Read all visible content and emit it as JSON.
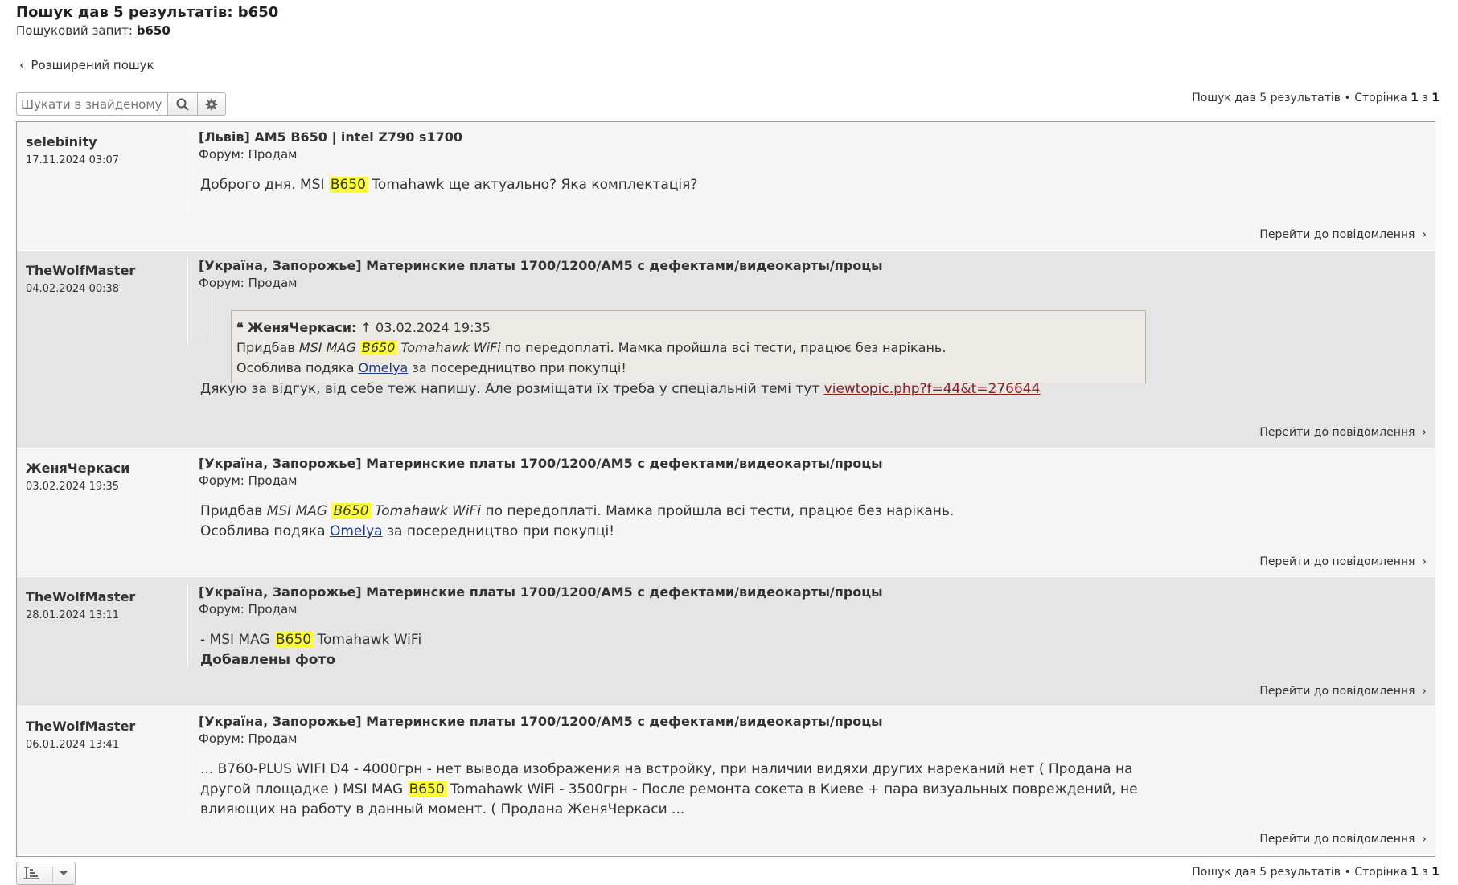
{
  "header": {
    "title": "Пошук дав 5 результатів: b650",
    "query_label": "Пошуковий запит:",
    "query_value": "b650",
    "advanced_link": "Розширений пошук"
  },
  "search_within": {
    "placeholder": "Шукати в знайденому"
  },
  "pagination": {
    "prefix": "Пошук дав 5 результатів • Сторінка",
    "current": "1",
    "sep": "з",
    "total": "1"
  },
  "posts": [
    {
      "author": "selebinity",
      "date": "17.11.2024 03:07",
      "title": "[Львів] AM5 B650 | intel Z790 s1700",
      "forum": "Форум: Продам",
      "text_before": "Доброго дня. MSI",
      "highlight": "B650",
      "text_after": "Tomahawk ще актуально? Яка комплектація?",
      "goto": "Перейти до повідомлення"
    },
    {
      "author": "TheWolfMaster",
      "date": "04.02.2024 00:38",
      "title": "[Україна, Запорожье] Материнские платы 1700/1200/AM5 с дефектами/видеокарты/процы",
      "forum": "Форум: Продам",
      "quote_author": "ЖеняЧеркаси:",
      "quote_arrow": "↑",
      "quote_date": "03.02.2024 19:35",
      "quote_line1_before": "Придбав",
      "quote_line1_italic1": "MSI MAG",
      "quote_line1_highlight": "B650",
      "quote_line1_italic2": "Tomahawk WiFi",
      "quote_line1_after": "по передоплаті. Мамка пройшла всі тести, працює без нарікань.",
      "quote_line2_before": "Особлива подяка",
      "quote_line2_link": "Omelya",
      "quote_line2_after": "за посередництво при покупці!",
      "text_before": "Дякую за відгук, від себе теж напишу. Але розміщати їх треба у спеціальній темі тут",
      "link": "viewtopic.php?f=44&t=276644",
      "goto": "Перейти до повідомлення"
    },
    {
      "author": "ЖеняЧеркаси",
      "date": "03.02.2024 19:35",
      "title": "[Україна, Запорожье] Материнские платы 1700/1200/AM5 с дефектами/видеокарты/процы",
      "forum": "Форум: Продам",
      "line1_before": "Придбав",
      "line1_italic1": "MSI MAG",
      "line1_highlight": "B650",
      "line1_italic2": "Tomahawk WiFi",
      "line1_after": "по передоплаті. Мамка пройшла всі тести, працює без нарікань.",
      "line2_before": "Особлива подяка",
      "line2_link": "Omelya",
      "line2_after": "за посередництво при покупці!",
      "goto": "Перейти до повідомлення"
    },
    {
      "author": "TheWolfMaster",
      "date": "28.01.2024 13:11",
      "title": "[Україна, Запорожье] Материнские платы 1700/1200/AM5 с дефектами/видеокарты/процы",
      "forum": "Форум: Продам",
      "line1_before": "- MSI MAG",
      "line1_highlight": "B650",
      "line1_after": "Tomahawk WiFi",
      "line2_bold": "Добавлены фото",
      "goto": "Перейти до повідомлення"
    },
    {
      "author": "TheWolfMaster",
      "date": "06.01.2024 13:41",
      "title": "[Україна, Запорожье] Материнские платы 1700/1200/AM5 с дефектами/видеокарты/процы",
      "forum": "Форум: Продам",
      "line1": "... B760-PLUS WIFI D4 - 4000грн - нет вывода изображения на встройку, при наличии видяхи других нареканий нет ( Продана на",
      "line2_before": "другой площадке ) MSI MAG",
      "line2_highlight": "B650",
      "line2_after": "Tomahawk WiFi - 3500грн - После ремонта сокета в Киеве + пара визуальных повреждений, не",
      "line3": "влияющих на работу в данный момент. ( Продана ЖеняЧеркаси ...",
      "goto": "Перейти до повідомлення"
    }
  ],
  "colors": {
    "highlight": "#ffff33",
    "row_light": "#f5f5f5",
    "row_dark": "#e5e5e5",
    "quote_bg": "#ebeae4",
    "link": "#1a3a8a",
    "link_visited": "#8a1e1e"
  }
}
